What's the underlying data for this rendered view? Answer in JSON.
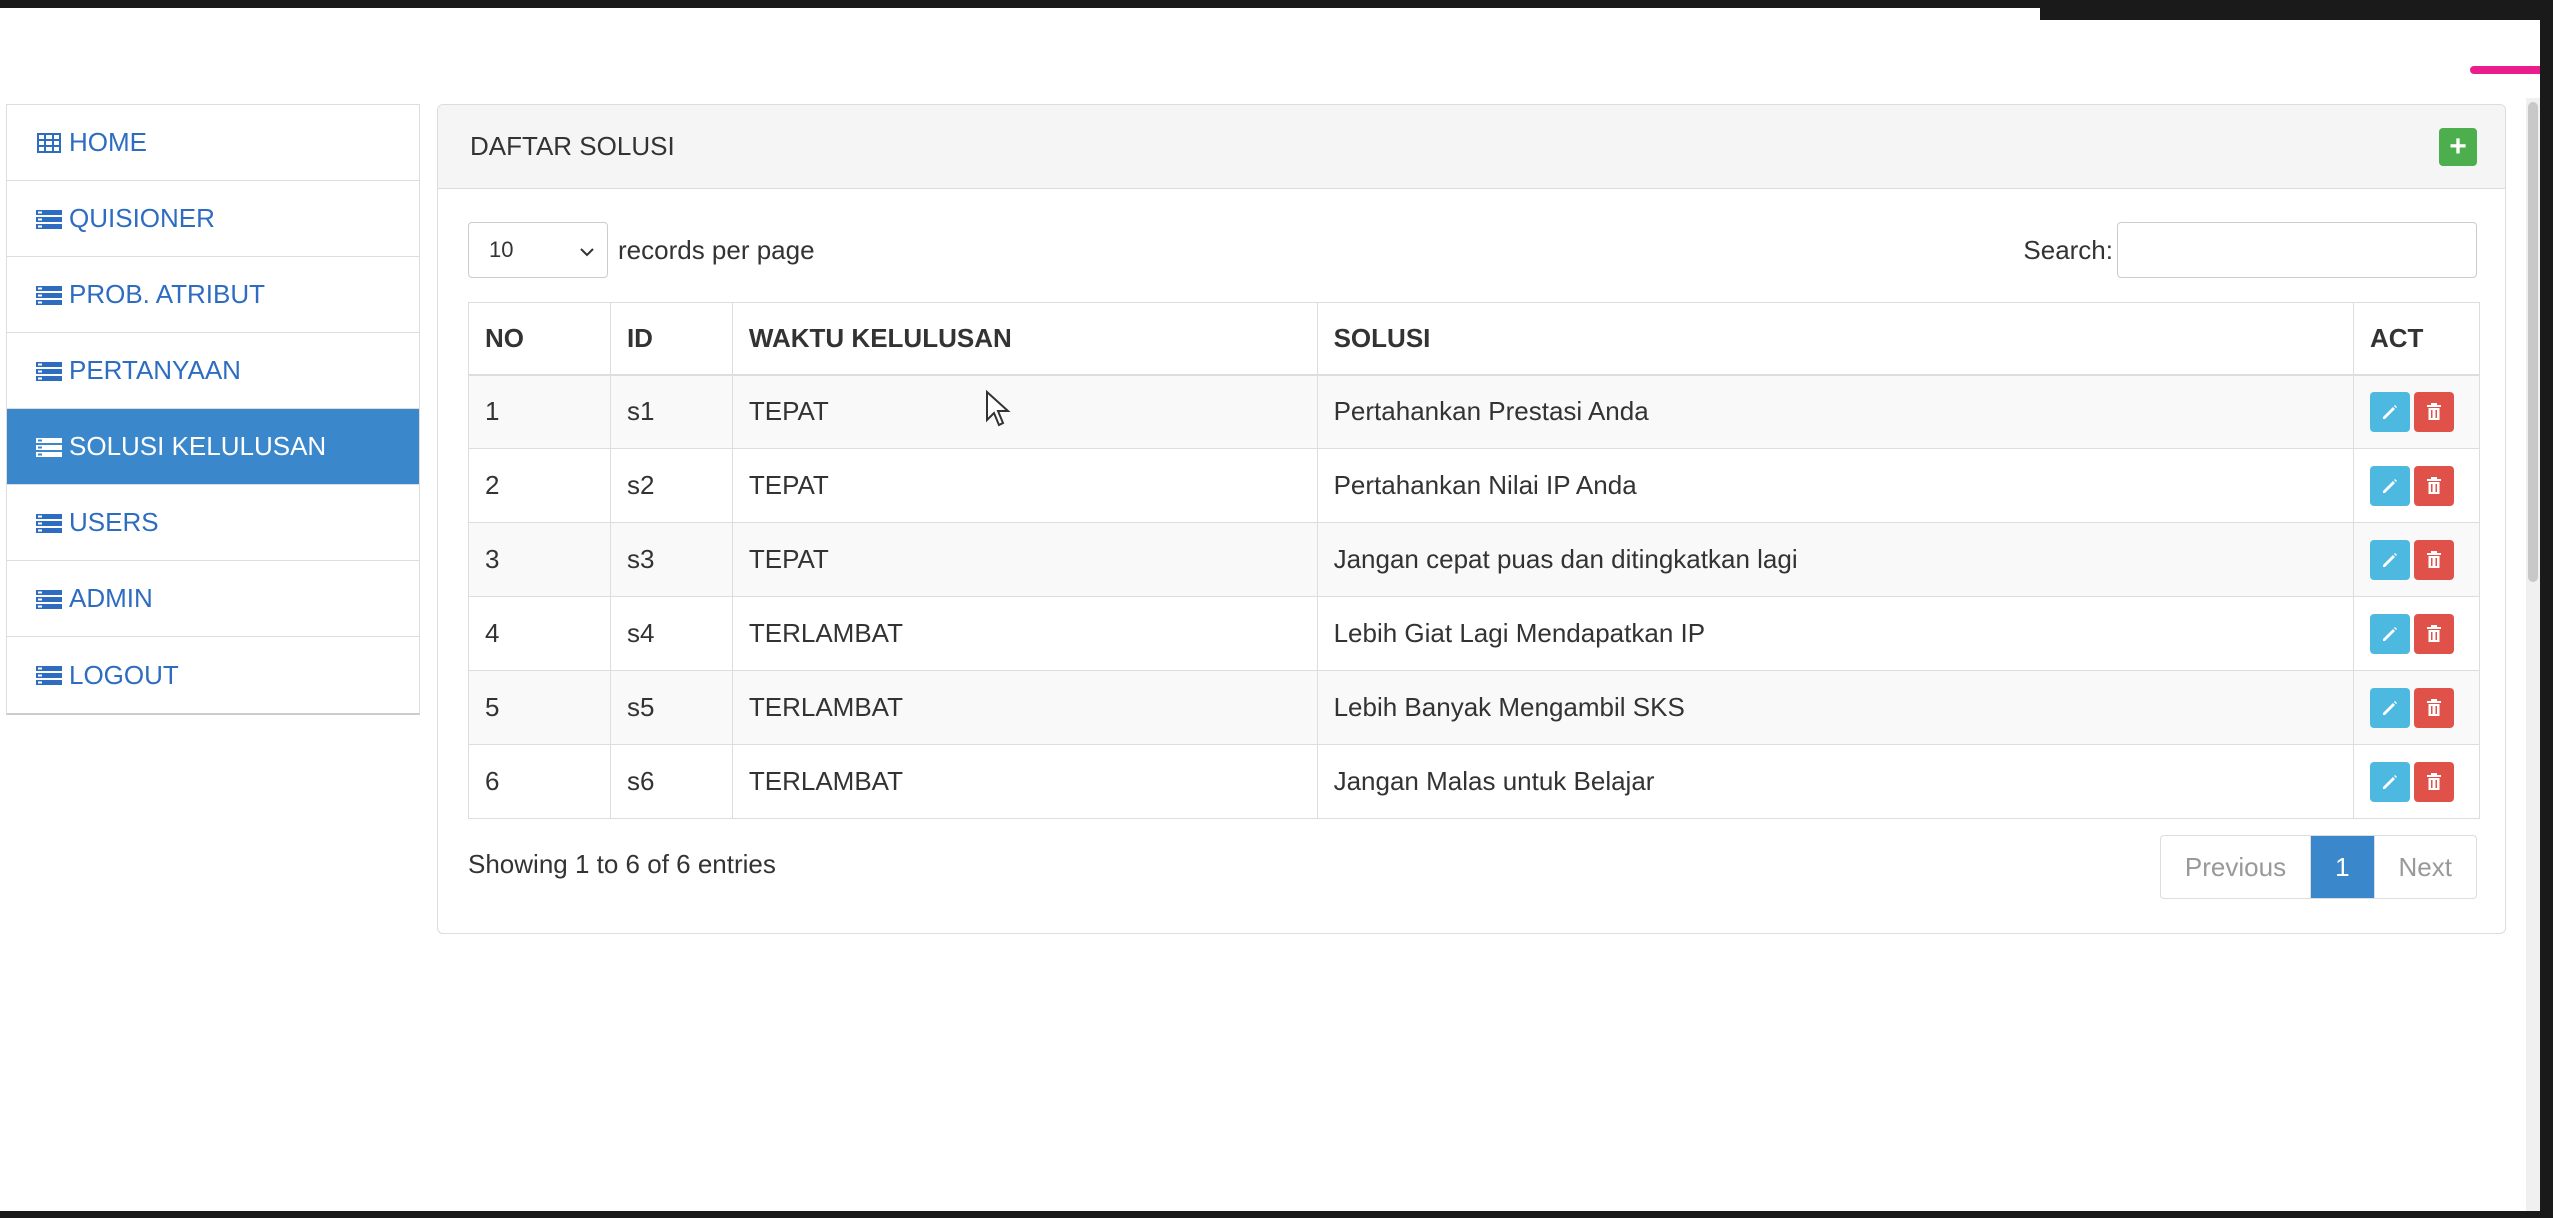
{
  "sidebar": {
    "items": [
      {
        "label": "HOME",
        "icon": "table-icon"
      },
      {
        "label": "QUISIONER",
        "icon": "list-icon"
      },
      {
        "label": "PROB. ATRIBUT",
        "icon": "list-icon"
      },
      {
        "label": "PERTANYAAN",
        "icon": "list-icon"
      },
      {
        "label": "SOLUSI KELULUSAN",
        "icon": "list-icon",
        "active": true
      },
      {
        "label": "USERS",
        "icon": "list-icon"
      },
      {
        "label": "ADMIN",
        "icon": "list-icon"
      },
      {
        "label": "LOGOUT",
        "icon": "list-icon"
      }
    ]
  },
  "panel": {
    "title": "DAFTAR SOLUSI",
    "add_label": "+"
  },
  "controls": {
    "length_value": "10",
    "length_suffix": "records per page",
    "search_label": "Search:",
    "search_value": ""
  },
  "table": {
    "headers": [
      "NO",
      "ID",
      "WAKTU KELULUSAN",
      "SOLUSI",
      "ACT"
    ],
    "rows": [
      [
        "1",
        "s1",
        "TEPAT",
        "Pertahankan Prestasi Anda"
      ],
      [
        "2",
        "s2",
        "TEPAT",
        "Pertahankan Nilai IP Anda"
      ],
      [
        "3",
        "s3",
        "TEPAT",
        "Jangan cepat puas dan ditingkatkan lagi"
      ],
      [
        "4",
        "s4",
        "TERLAMBAT",
        "Lebih Giat Lagi Mendapatkan IP"
      ],
      [
        "5",
        "s5",
        "TERLAMBAT",
        "Lebih Banyak Mengambil SKS"
      ],
      [
        "6",
        "s6",
        "TERLAMBAT",
        "Jangan Malas untuk Belajar"
      ]
    ]
  },
  "footer": {
    "info": "Showing 1 to 6 of 6 entries",
    "prev_label": "Previous",
    "page_label": "1",
    "next_label": "Next"
  },
  "colors": {
    "active": "#3a87cc",
    "link": "#2d6cc0",
    "add": "#4cae4c",
    "edit": "#4db8e0",
    "delete": "#e0514a"
  }
}
